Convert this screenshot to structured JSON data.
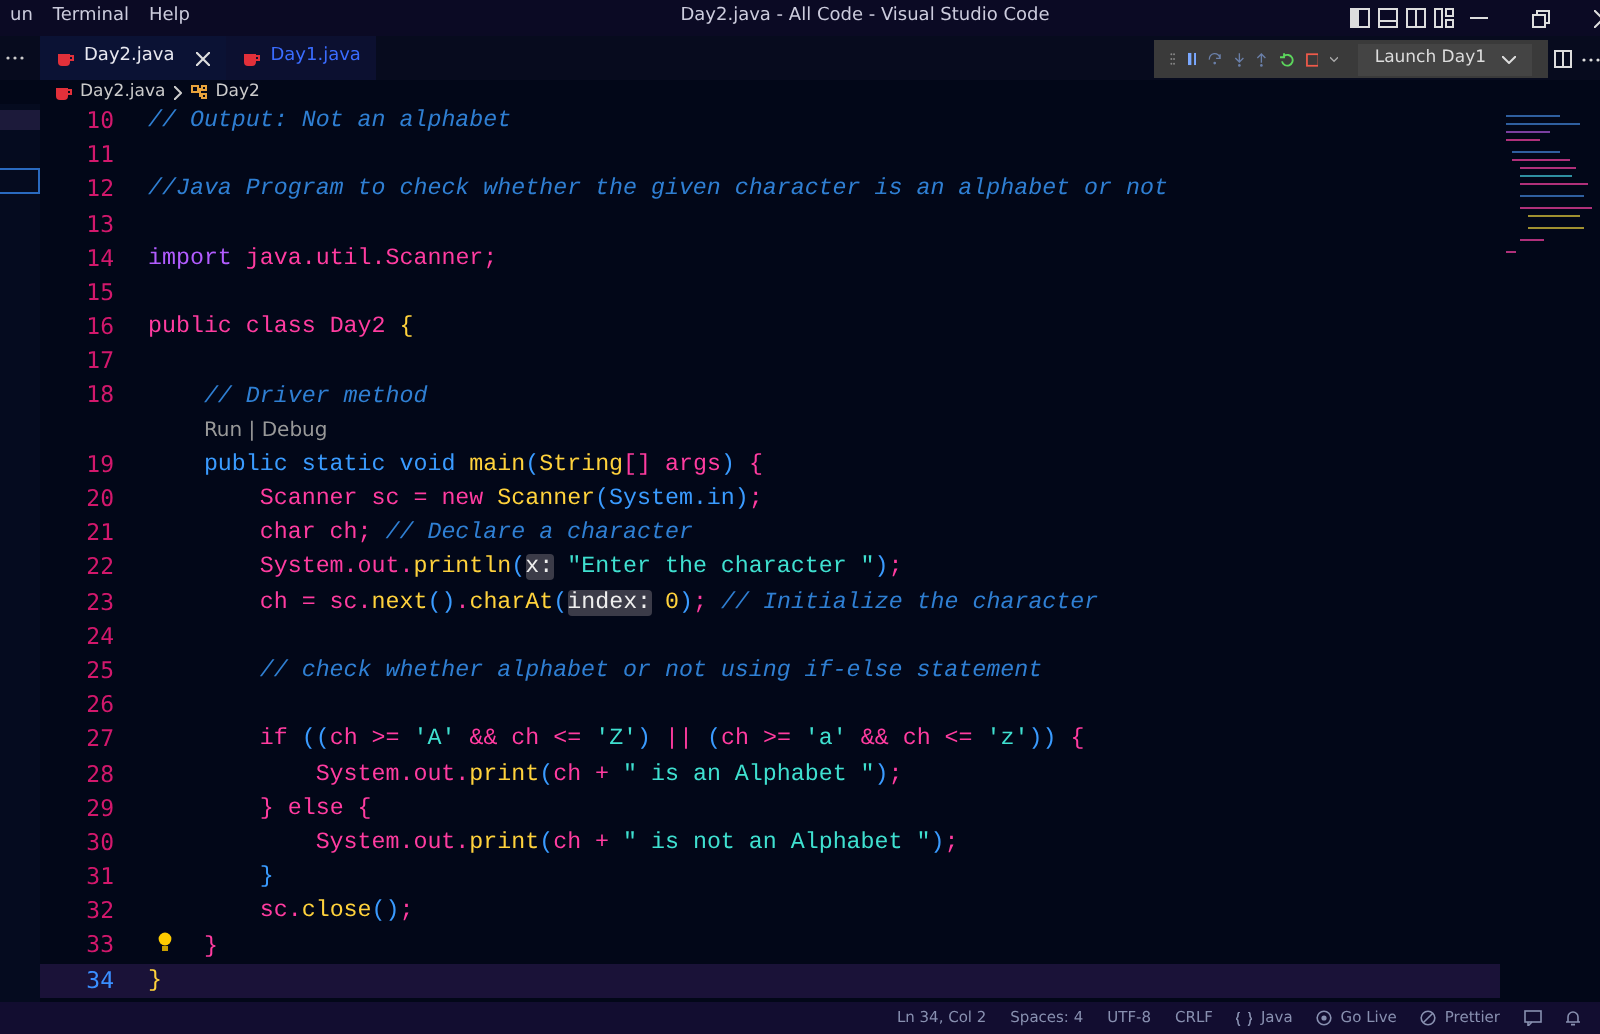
{
  "menu": [
    {
      "label": "un"
    },
    {
      "label": "Terminal"
    },
    {
      "label": "Help"
    }
  ],
  "window": {
    "title": "Day2.java - All Code - Visual Studio Code"
  },
  "tabs": [
    {
      "label": "Day2.java",
      "selected": true,
      "closable": true
    },
    {
      "label": "Day1.java",
      "selected": false,
      "closable": false
    }
  ],
  "debug_toolbar": {
    "launch_config": "Launch Day1"
  },
  "breadcrumb": [
    "Day2.java",
    "Day2"
  ],
  "lines": [
    {
      "kind": "code",
      "number": "10",
      "current": false,
      "lightbulb": false,
      "tokens": [
        {
          "kind": "comment",
          "text": "// Output: Not an alphabet"
        }
      ]
    },
    {
      "kind": "code",
      "number": "11",
      "current": false,
      "lightbulb": false
    },
    {
      "kind": "code",
      "number": "12",
      "current": false,
      "lightbulb": false,
      "tokens": [
        {
          "kind": "comment",
          "text": "//Java Program to check whether the given character is an alphabet or not"
        }
      ]
    },
    {
      "kind": "code",
      "number": "13",
      "current": false,
      "lightbulb": false
    },
    {
      "kind": "code",
      "number": "14",
      "current": false,
      "lightbulb": false,
      "tokens": [
        {
          "kind": "import",
          "text": "import "
        },
        {
          "kind": "id",
          "text": "java.util.Scanner;"
        }
      ]
    },
    {
      "kind": "code",
      "number": "15",
      "current": false,
      "lightbulb": false
    },
    {
      "kind": "code",
      "number": "16",
      "current": false,
      "lightbulb": false,
      "tokens": [
        {
          "kind": "kw",
          "text": "public class "
        },
        {
          "kind": "id",
          "text": "Day2 "
        },
        {
          "kind": "type",
          "text": "{"
        }
      ]
    },
    {
      "kind": "code",
      "number": "17",
      "current": false,
      "lightbulb": false
    },
    {
      "kind": "code",
      "number": "18",
      "current": false,
      "lightbulb": false,
      "tokens": [
        {
          "kind": "comment",
          "text": "    // Driver method"
        }
      ]
    },
    {
      "kind": "codelens",
      "text": "    Run | Debug"
    },
    {
      "kind": "code",
      "number": "19",
      "current": false,
      "lightbulb": false,
      "tokens": [
        {
          "kind": "kw2",
          "text": "    public static void "
        },
        {
          "kind": "method",
          "text": "main"
        },
        {
          "kind": "punc",
          "text": "("
        },
        {
          "kind": "type",
          "text": "String"
        },
        {
          "kind": "id",
          "text": "[] args"
        },
        {
          "kind": "punc",
          "text": ")"
        },
        {
          "kind": "id",
          "text": " {"
        }
      ]
    },
    {
      "kind": "code",
      "number": "20",
      "current": false,
      "lightbulb": false,
      "tokens": [
        {
          "kind": "id",
          "text": "        Scanner sc = "
        },
        {
          "kind": "kw",
          "text": "new "
        },
        {
          "kind": "type",
          "text": "Scanner"
        },
        {
          "kind": "punc",
          "text": "(System.in)"
        },
        {
          "kind": "id",
          "text": ";"
        }
      ]
    },
    {
      "kind": "code",
      "number": "21",
      "current": false,
      "lightbulb": false,
      "tokens": [
        {
          "kind": "id",
          "text": "        char ch; "
        },
        {
          "kind": "comment",
          "text": "// Declare a character"
        }
      ]
    },
    {
      "kind": "code",
      "number": "22",
      "current": false,
      "lightbulb": false,
      "tokens": [
        {
          "kind": "id",
          "text": "        System.out."
        },
        {
          "kind": "method",
          "text": "println"
        },
        {
          "kind": "punc",
          "text": "("
        },
        {
          "kind": "hint",
          "text": "x:"
        },
        {
          "kind": "str",
          "text": " \"Enter the character \""
        },
        {
          "kind": "punc",
          "text": ")"
        },
        {
          "kind": "id",
          "text": ";"
        }
      ]
    },
    {
      "kind": "code",
      "number": "23",
      "current": false,
      "lightbulb": false,
      "tokens": [
        {
          "kind": "id",
          "text": "        ch = sc."
        },
        {
          "kind": "method",
          "text": "next"
        },
        {
          "kind": "punc",
          "text": "()"
        },
        {
          "kind": "id",
          "text": "."
        },
        {
          "kind": "method",
          "text": "charAt"
        },
        {
          "kind": "punc",
          "text": "("
        },
        {
          "kind": "hint",
          "text": "index:"
        },
        {
          "kind": "num",
          "text": " 0"
        },
        {
          "kind": "punc",
          "text": ")"
        },
        {
          "kind": "id",
          "text": "; "
        },
        {
          "kind": "comment",
          "text": "// Initialize the character"
        }
      ]
    },
    {
      "kind": "code",
      "number": "24",
      "current": false,
      "lightbulb": false
    },
    {
      "kind": "code",
      "number": "25",
      "current": false,
      "lightbulb": false,
      "tokens": [
        {
          "kind": "comment",
          "text": "        // check whether alphabet or not using if-else statement"
        }
      ]
    },
    {
      "kind": "code",
      "number": "26",
      "current": false,
      "lightbulb": false
    },
    {
      "kind": "code",
      "number": "27",
      "current": false,
      "lightbulb": false,
      "tokens": [
        {
          "kind": "kw",
          "text": "        if "
        },
        {
          "kind": "punc",
          "text": "(("
        },
        {
          "kind": "id",
          "text": "ch >= "
        },
        {
          "kind": "str",
          "text": "'A'"
        },
        {
          "kind": "id",
          "text": " && ch <= "
        },
        {
          "kind": "str",
          "text": "'Z'"
        },
        {
          "kind": "punc",
          "text": ")"
        },
        {
          "kind": "id",
          "text": " || "
        },
        {
          "kind": "punc",
          "text": "("
        },
        {
          "kind": "id",
          "text": "ch >= "
        },
        {
          "kind": "str",
          "text": "'a'"
        },
        {
          "kind": "id",
          "text": " && ch <= "
        },
        {
          "kind": "str",
          "text": "'z'"
        },
        {
          "kind": "punc",
          "text": "))"
        },
        {
          "kind": "id",
          "text": " {"
        }
      ]
    },
    {
      "kind": "code",
      "number": "28",
      "current": false,
      "lightbulb": false,
      "tokens": [
        {
          "kind": "id",
          "text": "            System.out."
        },
        {
          "kind": "method",
          "text": "print"
        },
        {
          "kind": "punc",
          "text": "("
        },
        {
          "kind": "id",
          "text": "ch + "
        },
        {
          "kind": "str",
          "text": "\" is an Alphabet \""
        },
        {
          "kind": "punc",
          "text": ")"
        },
        {
          "kind": "id",
          "text": ";"
        }
      ]
    },
    {
      "kind": "code",
      "number": "29",
      "current": false,
      "lightbulb": false,
      "tokens": [
        {
          "kind": "id",
          "text": "        } "
        },
        {
          "kind": "kw",
          "text": "else"
        },
        {
          "kind": "id",
          "text": " {"
        }
      ]
    },
    {
      "kind": "code",
      "number": "30",
      "current": false,
      "lightbulb": false,
      "tokens": [
        {
          "kind": "id",
          "text": "            System.out."
        },
        {
          "kind": "method",
          "text": "print"
        },
        {
          "kind": "punc",
          "text": "("
        },
        {
          "kind": "id",
          "text": "ch + "
        },
        {
          "kind": "str",
          "text": "\" is not an Alphabet \""
        },
        {
          "kind": "punc",
          "text": ")"
        },
        {
          "kind": "id",
          "text": ";"
        }
      ]
    },
    {
      "kind": "code",
      "number": "31",
      "current": false,
      "lightbulb": false,
      "tokens": [
        {
          "kind": "punc",
          "text": "        }"
        }
      ]
    },
    {
      "kind": "code",
      "number": "32",
      "current": false,
      "lightbulb": false,
      "tokens": [
        {
          "kind": "id",
          "text": "        sc."
        },
        {
          "kind": "method",
          "text": "close"
        },
        {
          "kind": "punc",
          "text": "()"
        },
        {
          "kind": "id",
          "text": ";"
        }
      ]
    },
    {
      "kind": "code",
      "number": "33",
      "current": false,
      "lightbulb": true,
      "tokens": [
        {
          "kind": "id",
          "text": "    }"
        }
      ]
    },
    {
      "kind": "code",
      "number": "34",
      "current": true,
      "lightbulb": false,
      "tokens": [
        {
          "kind": "type",
          "text": "}"
        }
      ]
    }
  ],
  "status_bar": [
    {
      "kind": "text",
      "text": "Ln 34, Col 2"
    },
    {
      "kind": "text",
      "text": "Spaces: 4"
    },
    {
      "kind": "text",
      "text": "UTF-8"
    },
    {
      "kind": "text",
      "text": "CRLF"
    },
    {
      "kind": "lang",
      "text": "Java"
    },
    {
      "kind": "golive",
      "text": "Go Live"
    },
    {
      "kind": "prettier",
      "text": "Prettier"
    }
  ]
}
